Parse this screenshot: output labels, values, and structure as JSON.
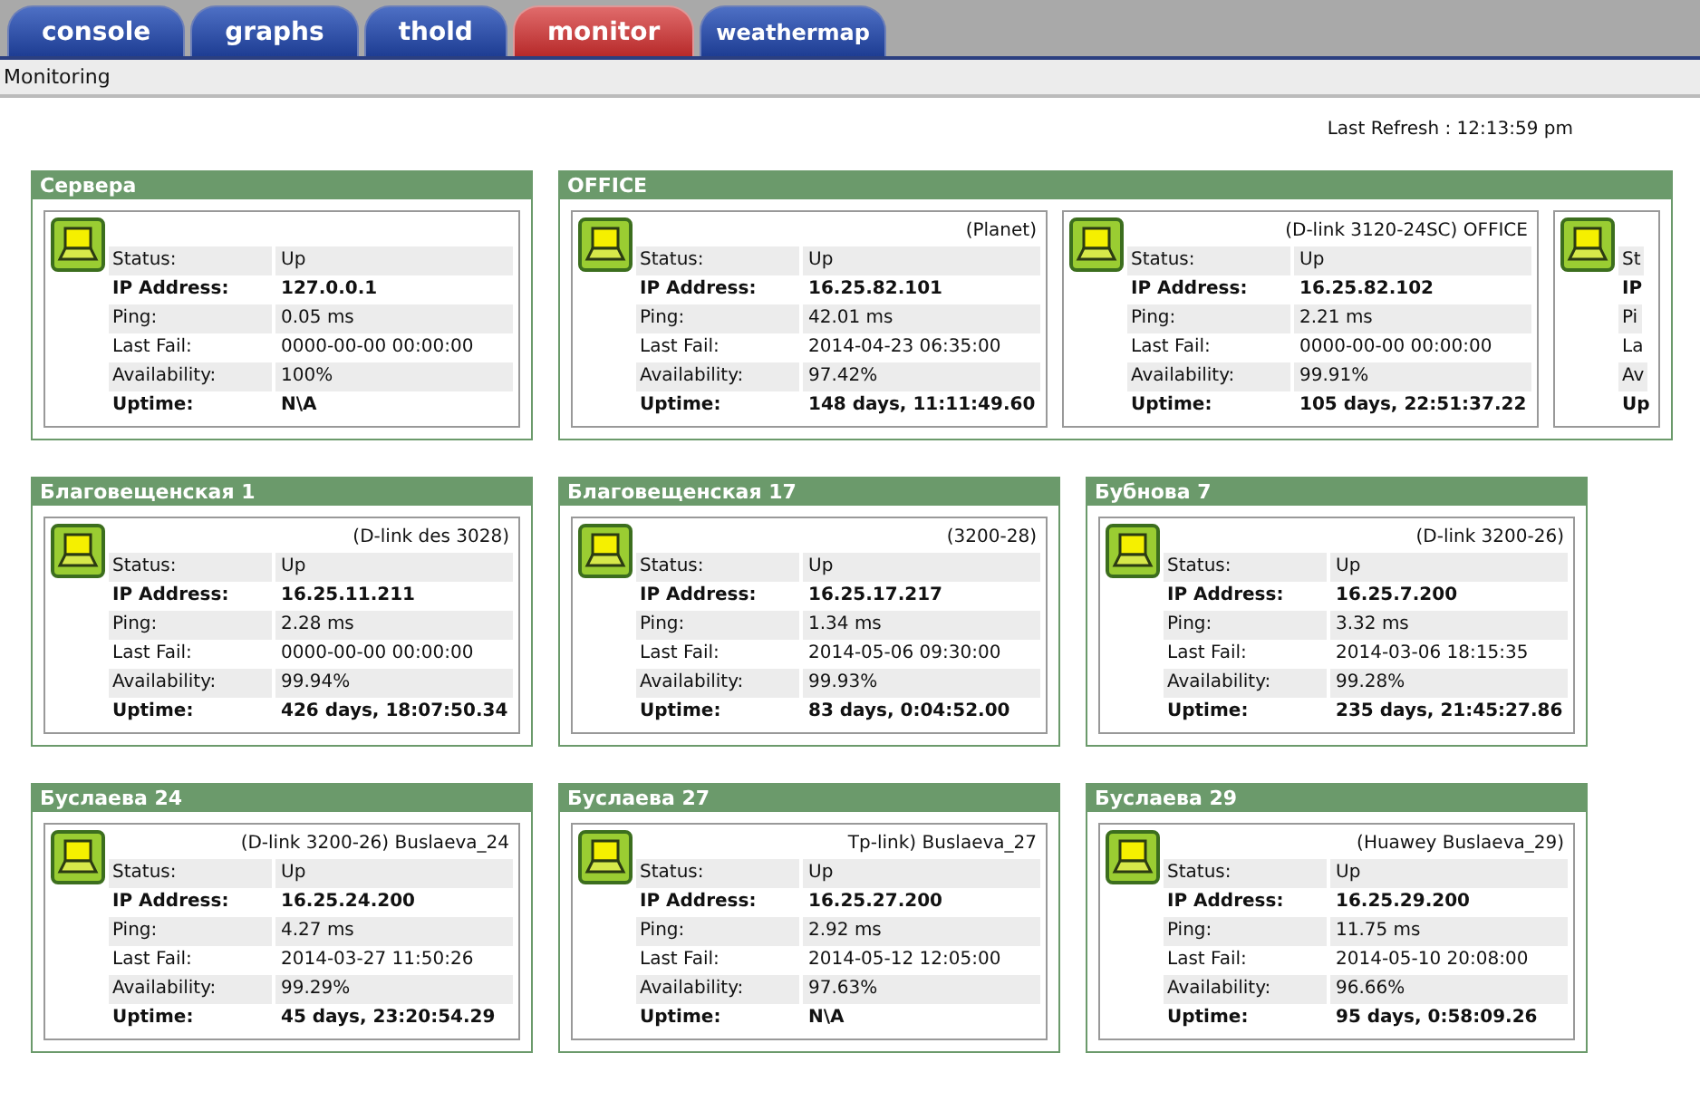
{
  "tabs": [
    {
      "label": "console",
      "selected": false
    },
    {
      "label": "graphs",
      "selected": false
    },
    {
      "label": "thold",
      "selected": false
    },
    {
      "label": "monitor",
      "selected": true
    },
    {
      "label": "weathermap",
      "selected": false
    }
  ],
  "breadcrumb": "Monitoring",
  "last_refresh": "Last Refresh : 12:13:59 pm",
  "group_rows": [
    {
      "groups": [
        {
          "name": "Сервера",
          "devices": [
            {
              "rows": [
                {
                  "label": "Status:",
                  "value": "Up",
                  "bold": false
                },
                {
                  "label": "IP Address:",
                  "value": "127.0.0.1",
                  "bold": true
                },
                {
                  "label": "Ping:",
                  "value": "0.05 ms",
                  "bold": false
                },
                {
                  "label": "Last Fail:",
                  "value": "0000-00-00 00:00:00",
                  "bold": false
                },
                {
                  "label": "Availability:",
                  "value": "100%",
                  "bold": false
                },
                {
                  "label": "Uptime:",
                  "value": "N\\A",
                  "bold": true
                }
              ]
            }
          ]
        },
        {
          "name": "OFFICE",
          "devices": [
            {
              "title": "(Planet)",
              "rows": [
                {
                  "label": "Status:",
                  "value": "Up",
                  "bold": false
                },
                {
                  "label": "IP Address:",
                  "value": "16.25.82.101",
                  "bold": true
                },
                {
                  "label": "Ping:",
                  "value": "42.01 ms",
                  "bold": false
                },
                {
                  "label": "Last Fail:",
                  "value": "2014-04-23 06:35:00",
                  "bold": false
                },
                {
                  "label": "Availability:",
                  "value": "97.42%",
                  "bold": false
                },
                {
                  "label": "Uptime:",
                  "value": "148 days, 11:11:49.60",
                  "bold": true
                }
              ]
            },
            {
              "title": "(D-link 3120-24SC) OFFICE",
              "rows": [
                {
                  "label": "Status:",
                  "value": "Up",
                  "bold": false
                },
                {
                  "label": "IP Address:",
                  "value": "16.25.82.102",
                  "bold": true
                },
                {
                  "label": "Ping:",
                  "value": "2.21 ms",
                  "bold": false
                },
                {
                  "label": "Last Fail:",
                  "value": "0000-00-00 00:00:00",
                  "bold": false
                },
                {
                  "label": "Availability:",
                  "value": "99.91%",
                  "bold": false
                },
                {
                  "label": "Uptime:",
                  "value": "105 days, 22:51:37.22",
                  "bold": true
                }
              ]
            },
            {
              "rows": [
                {
                  "label": "St",
                  "bold": false
                },
                {
                  "label": "IP",
                  "bold": true
                },
                {
                  "label": "Pi",
                  "bold": false
                },
                {
                  "label": "La",
                  "bold": false
                },
                {
                  "label": "Av",
                  "bold": false
                },
                {
                  "label": "Up",
                  "bold": true
                }
              ]
            }
          ]
        }
      ]
    },
    {
      "groups": [
        {
          "name": "Благовещенская 1",
          "devices": [
            {
              "title": "(D-link des 3028)",
              "rows": [
                {
                  "label": "Status:",
                  "value": "Up",
                  "bold": false
                },
                {
                  "label": "IP Address:",
                  "value": "16.25.11.211",
                  "bold": true
                },
                {
                  "label": "Ping:",
                  "value": "2.28 ms",
                  "bold": false
                },
                {
                  "label": "Last Fail:",
                  "value": "0000-00-00 00:00:00",
                  "bold": false
                },
                {
                  "label": "Availability:",
                  "value": "99.94%",
                  "bold": false
                },
                {
                  "label": "Uptime:",
                  "value": "426 days, 18:07:50.34",
                  "bold": true
                }
              ]
            }
          ]
        },
        {
          "name": "Благовещенская 17",
          "devices": [
            {
              "title": "(3200-28)",
              "rows": [
                {
                  "label": "Status:",
                  "value": "Up",
                  "bold": false
                },
                {
                  "label": "IP Address:",
                  "value": "16.25.17.217",
                  "bold": true
                },
                {
                  "label": "Ping:",
                  "value": "1.34 ms",
                  "bold": false
                },
                {
                  "label": "Last Fail:",
                  "value": "2014-05-06 09:30:00",
                  "bold": false
                },
                {
                  "label": "Availability:",
                  "value": "99.93%",
                  "bold": false
                },
                {
                  "label": "Uptime:",
                  "value": "83 days, 0:04:52.00",
                  "bold": true
                }
              ]
            }
          ]
        },
        {
          "name": "Бубнова 7",
          "devices": [
            {
              "title": "(D-link 3200-26)",
              "rows": [
                {
                  "label": "Status:",
                  "value": "Up",
                  "bold": false
                },
                {
                  "label": "IP Address:",
                  "value": "16.25.7.200",
                  "bold": true
                },
                {
                  "label": "Ping:",
                  "value": "3.32 ms",
                  "bold": false
                },
                {
                  "label": "Last Fail:",
                  "value": "2014-03-06 18:15:35",
                  "bold": false
                },
                {
                  "label": "Availability:",
                  "value": "99.28%",
                  "bold": false
                },
                {
                  "label": "Uptime:",
                  "value": "235 days, 21:45:27.86",
                  "bold": true
                }
              ]
            }
          ]
        }
      ]
    },
    {
      "groups": [
        {
          "name": "Буслаева 24",
          "devices": [
            {
              "title": "(D-link 3200-26) Buslaeva_24",
              "rows": [
                {
                  "label": "Status:",
                  "value": "Up",
                  "bold": false
                },
                {
                  "label": "IP Address:",
                  "value": "16.25.24.200",
                  "bold": true
                },
                {
                  "label": "Ping:",
                  "value": "4.27 ms",
                  "bold": false
                },
                {
                  "label": "Last Fail:",
                  "value": "2014-03-27 11:50:26",
                  "bold": false
                },
                {
                  "label": "Availability:",
                  "value": "99.29%",
                  "bold": false
                },
                {
                  "label": "Uptime:",
                  "value": "45 days, 23:20:54.29",
                  "bold": true
                }
              ]
            }
          ]
        },
        {
          "name": "Буслаева 27",
          "devices": [
            {
              "title": "Tp-link) Buslaeva_27",
              "rows": [
                {
                  "label": "Status:",
                  "value": "Up",
                  "bold": false
                },
                {
                  "label": "IP Address:",
                  "value": "16.25.27.200",
                  "bold": true
                },
                {
                  "label": "Ping:",
                  "value": "2.92 ms",
                  "bold": false
                },
                {
                  "label": "Last Fail:",
                  "value": "2014-05-12 12:05:00",
                  "bold": false
                },
                {
                  "label": "Availability:",
                  "value": "97.63%",
                  "bold": false
                },
                {
                  "label": "Uptime:",
                  "value": "N\\A",
                  "bold": true
                }
              ]
            }
          ]
        },
        {
          "name": "Буслаева 29",
          "devices": [
            {
              "title": "(Huawey Buslaeva_29)",
              "rows": [
                {
                  "label": "Status:",
                  "value": "Up",
                  "bold": false
                },
                {
                  "label": "IP Address:",
                  "value": "16.25.29.200",
                  "bold": true
                },
                {
                  "label": "Ping:",
                  "value": "11.75 ms",
                  "bold": false
                },
                {
                  "label": "Last Fail:",
                  "value": "2014-05-10 20:08:00",
                  "bold": false
                },
                {
                  "label": "Availability:",
                  "value": "96.66%",
                  "bold": false
                },
                {
                  "label": "Uptime:",
                  "value": "95 days, 0:58:09.26",
                  "bold": true
                }
              ]
            }
          ]
        }
      ]
    }
  ]
}
